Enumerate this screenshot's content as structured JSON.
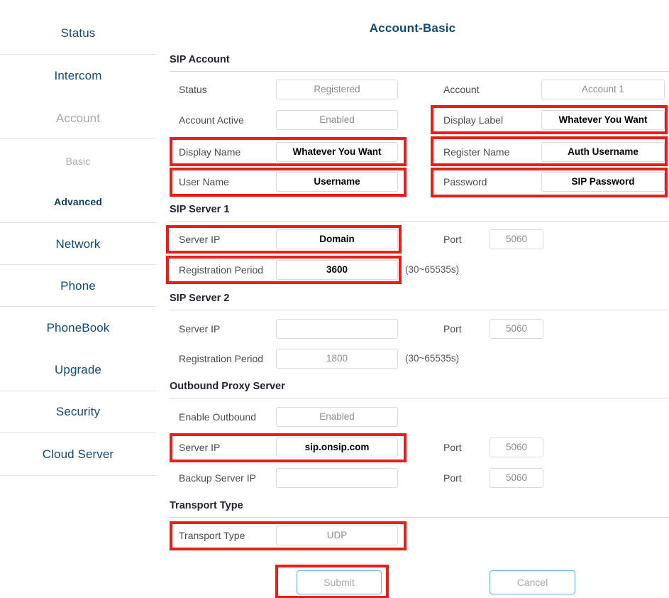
{
  "sidebar": {
    "items": [
      {
        "label": "Status",
        "state": "normal",
        "level": "top"
      },
      {
        "label": "Intercom",
        "state": "normal",
        "level": "top"
      },
      {
        "label": "Account",
        "state": "muted",
        "level": "top"
      },
      {
        "label": "Basic",
        "state": "muted",
        "level": "sub"
      },
      {
        "label": "Advanced",
        "state": "active",
        "level": "sub"
      },
      {
        "label": "Network",
        "state": "normal",
        "level": "top"
      },
      {
        "label": "Phone",
        "state": "normal",
        "level": "top"
      },
      {
        "label": "PhoneBook",
        "state": "normal",
        "level": "top"
      },
      {
        "label": "Upgrade",
        "state": "normal",
        "level": "top"
      },
      {
        "label": "Security",
        "state": "normal",
        "level": "top"
      },
      {
        "label": "Cloud Server",
        "state": "normal",
        "level": "top"
      }
    ]
  },
  "header": {
    "title": "Account-Basic"
  },
  "sections": {
    "sip_account": {
      "heading": "SIP Account",
      "status_label": "Status",
      "status_value": "Registered",
      "account_label": "Account",
      "account_value": "Account 1",
      "account_active_label": "Account Active",
      "account_active_value": "Enabled",
      "display_label_label": "Display Label",
      "display_label_value": "Whatever You Want",
      "display_name_label": "Display Name",
      "display_name_value": "Whatever You Want",
      "register_name_label": "Register Name",
      "register_name_value": "Auth Username",
      "user_name_label": "User Name",
      "user_name_value": "Username",
      "password_label": "Password",
      "password_value": "SIP Password"
    },
    "sip_server_1": {
      "heading": "SIP Server 1",
      "server_ip_label": "Server IP",
      "server_ip_value": "Domain",
      "port_label": "Port",
      "port_value": "5060",
      "registration_period_label": "Registration Period",
      "registration_period_value": "3600",
      "registration_period_hint": "(30~65535s)"
    },
    "sip_server_2": {
      "heading": "SIP Server 2",
      "server_ip_label": "Server IP",
      "server_ip_value": "",
      "port_label": "Port",
      "port_value": "5060",
      "registration_period_label": "Registration Period",
      "registration_period_value": "1800",
      "registration_period_hint": "(30~65535s)"
    },
    "outbound_proxy": {
      "heading": "Outbound Proxy Server",
      "enable_outbound_label": "Enable Outbound",
      "enable_outbound_value": "Enabled",
      "server_ip_label": "Server IP",
      "server_ip_value": "sip.onsip.com",
      "server_ip_port_label": "Port",
      "server_ip_port_value": "5060",
      "backup_server_ip_label": "Backup Server IP",
      "backup_server_ip_value": "",
      "backup_port_label": "Port",
      "backup_port_value": "5060"
    },
    "transport": {
      "heading": "Transport Type",
      "transport_type_label": "Transport Type",
      "transport_type_value": "UDP"
    }
  },
  "actions": {
    "submit_label": "Submit",
    "cancel_label": "Cancel"
  },
  "annotations": {
    "highlight_color": "#ec1c16",
    "count": 9
  }
}
